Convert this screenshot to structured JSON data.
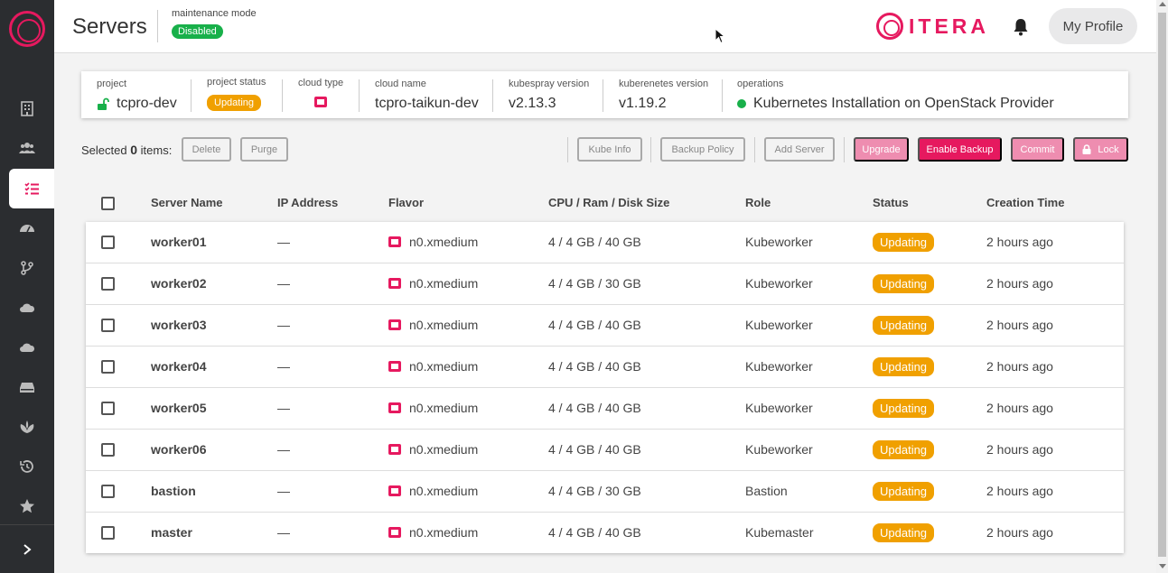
{
  "sidebar": {
    "items": [
      "organizations-icon",
      "users-icon",
      "servers-list-icon",
      "dashboard-icon",
      "git-branch-icon",
      "cloud-icon",
      "cloud-alt-icon",
      "storage-icon",
      "plant-icon",
      "history-icon",
      "star-icon"
    ],
    "active_index": 2
  },
  "header": {
    "title": "Servers",
    "maintenance_label": "maintenance mode",
    "maintenance_status": "Disabled",
    "brand": "ITERA",
    "profile_label": "My Profile"
  },
  "info": {
    "project_label": "project",
    "project_value": "tcpro-dev",
    "project_status_label": "project status",
    "project_status_value": "Updating",
    "cloud_type_label": "cloud type",
    "cloud_name_label": "cloud name",
    "cloud_name_value": "tcpro-taikun-dev",
    "kubespray_label": "kubespray version",
    "kubespray_value": "v2.13.3",
    "kubernetes_label": "kuberenetes version",
    "kubernetes_value": "v1.19.2",
    "operations_label": "operations",
    "operations_value": "Kubernetes Installation on OpenStack Provider"
  },
  "actions": {
    "selected_prefix": "Selected",
    "selected_count": "0",
    "selected_suffix": "items:",
    "delete": "Delete",
    "purge": "Purge",
    "kube_info": "Kube Info",
    "backup_policy": "Backup Policy",
    "add_server": "Add Server",
    "upgrade": "Upgrade",
    "enable_backup": "Enable Backup",
    "commit": "Commit",
    "lock": "Lock"
  },
  "table": {
    "headers": [
      "Server Name",
      "IP Address",
      "Flavor",
      "CPU / Ram / Disk Size",
      "Role",
      "Status",
      "Creation Time"
    ],
    "rows": [
      {
        "name": "worker01",
        "ip": "—",
        "flavor": "n0.xmedium",
        "spec": "4 / 4 GB / 40 GB",
        "role": "Kubeworker",
        "status": "Updating",
        "created": "2 hours ago"
      },
      {
        "name": "worker02",
        "ip": "—",
        "flavor": "n0.xmedium",
        "spec": "4 / 4 GB / 30 GB",
        "role": "Kubeworker",
        "status": "Updating",
        "created": "2 hours ago"
      },
      {
        "name": "worker03",
        "ip": "—",
        "flavor": "n0.xmedium",
        "spec": "4 / 4 GB / 40 GB",
        "role": "Kubeworker",
        "status": "Updating",
        "created": "2 hours ago"
      },
      {
        "name": "worker04",
        "ip": "—",
        "flavor": "n0.xmedium",
        "spec": "4 / 4 GB / 40 GB",
        "role": "Kubeworker",
        "status": "Updating",
        "created": "2 hours ago"
      },
      {
        "name": "worker05",
        "ip": "—",
        "flavor": "n0.xmedium",
        "spec": "4 / 4 GB / 40 GB",
        "role": "Kubeworker",
        "status": "Updating",
        "created": "2 hours ago"
      },
      {
        "name": "worker06",
        "ip": "—",
        "flavor": "n0.xmedium",
        "spec": "4 / 4 GB / 40 GB",
        "role": "Kubeworker",
        "status": "Updating",
        "created": "2 hours ago"
      },
      {
        "name": "bastion",
        "ip": "—",
        "flavor": "n0.xmedium",
        "spec": "4 / 4 GB / 30 GB",
        "role": "Bastion",
        "status": "Updating",
        "created": "2 hours ago"
      },
      {
        "name": "master",
        "ip": "—",
        "flavor": "n0.xmedium",
        "spec": "4 / 4 GB / 40 GB",
        "role": "Kubemaster",
        "status": "Updating",
        "created": "2 hours ago"
      }
    ]
  },
  "colors": {
    "accent": "#e6195f",
    "accent_light": "#ee8db0",
    "status_updating": "#f0a000",
    "status_ok": "#18b04a",
    "sidebar_bg": "#2b2d30"
  }
}
